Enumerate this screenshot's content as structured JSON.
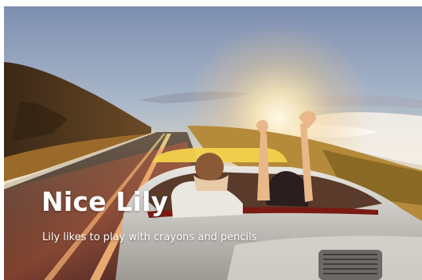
{
  "slide": {
    "title": "Nice Lily",
    "description": "Lily likes to play with crayons and pencils"
  }
}
